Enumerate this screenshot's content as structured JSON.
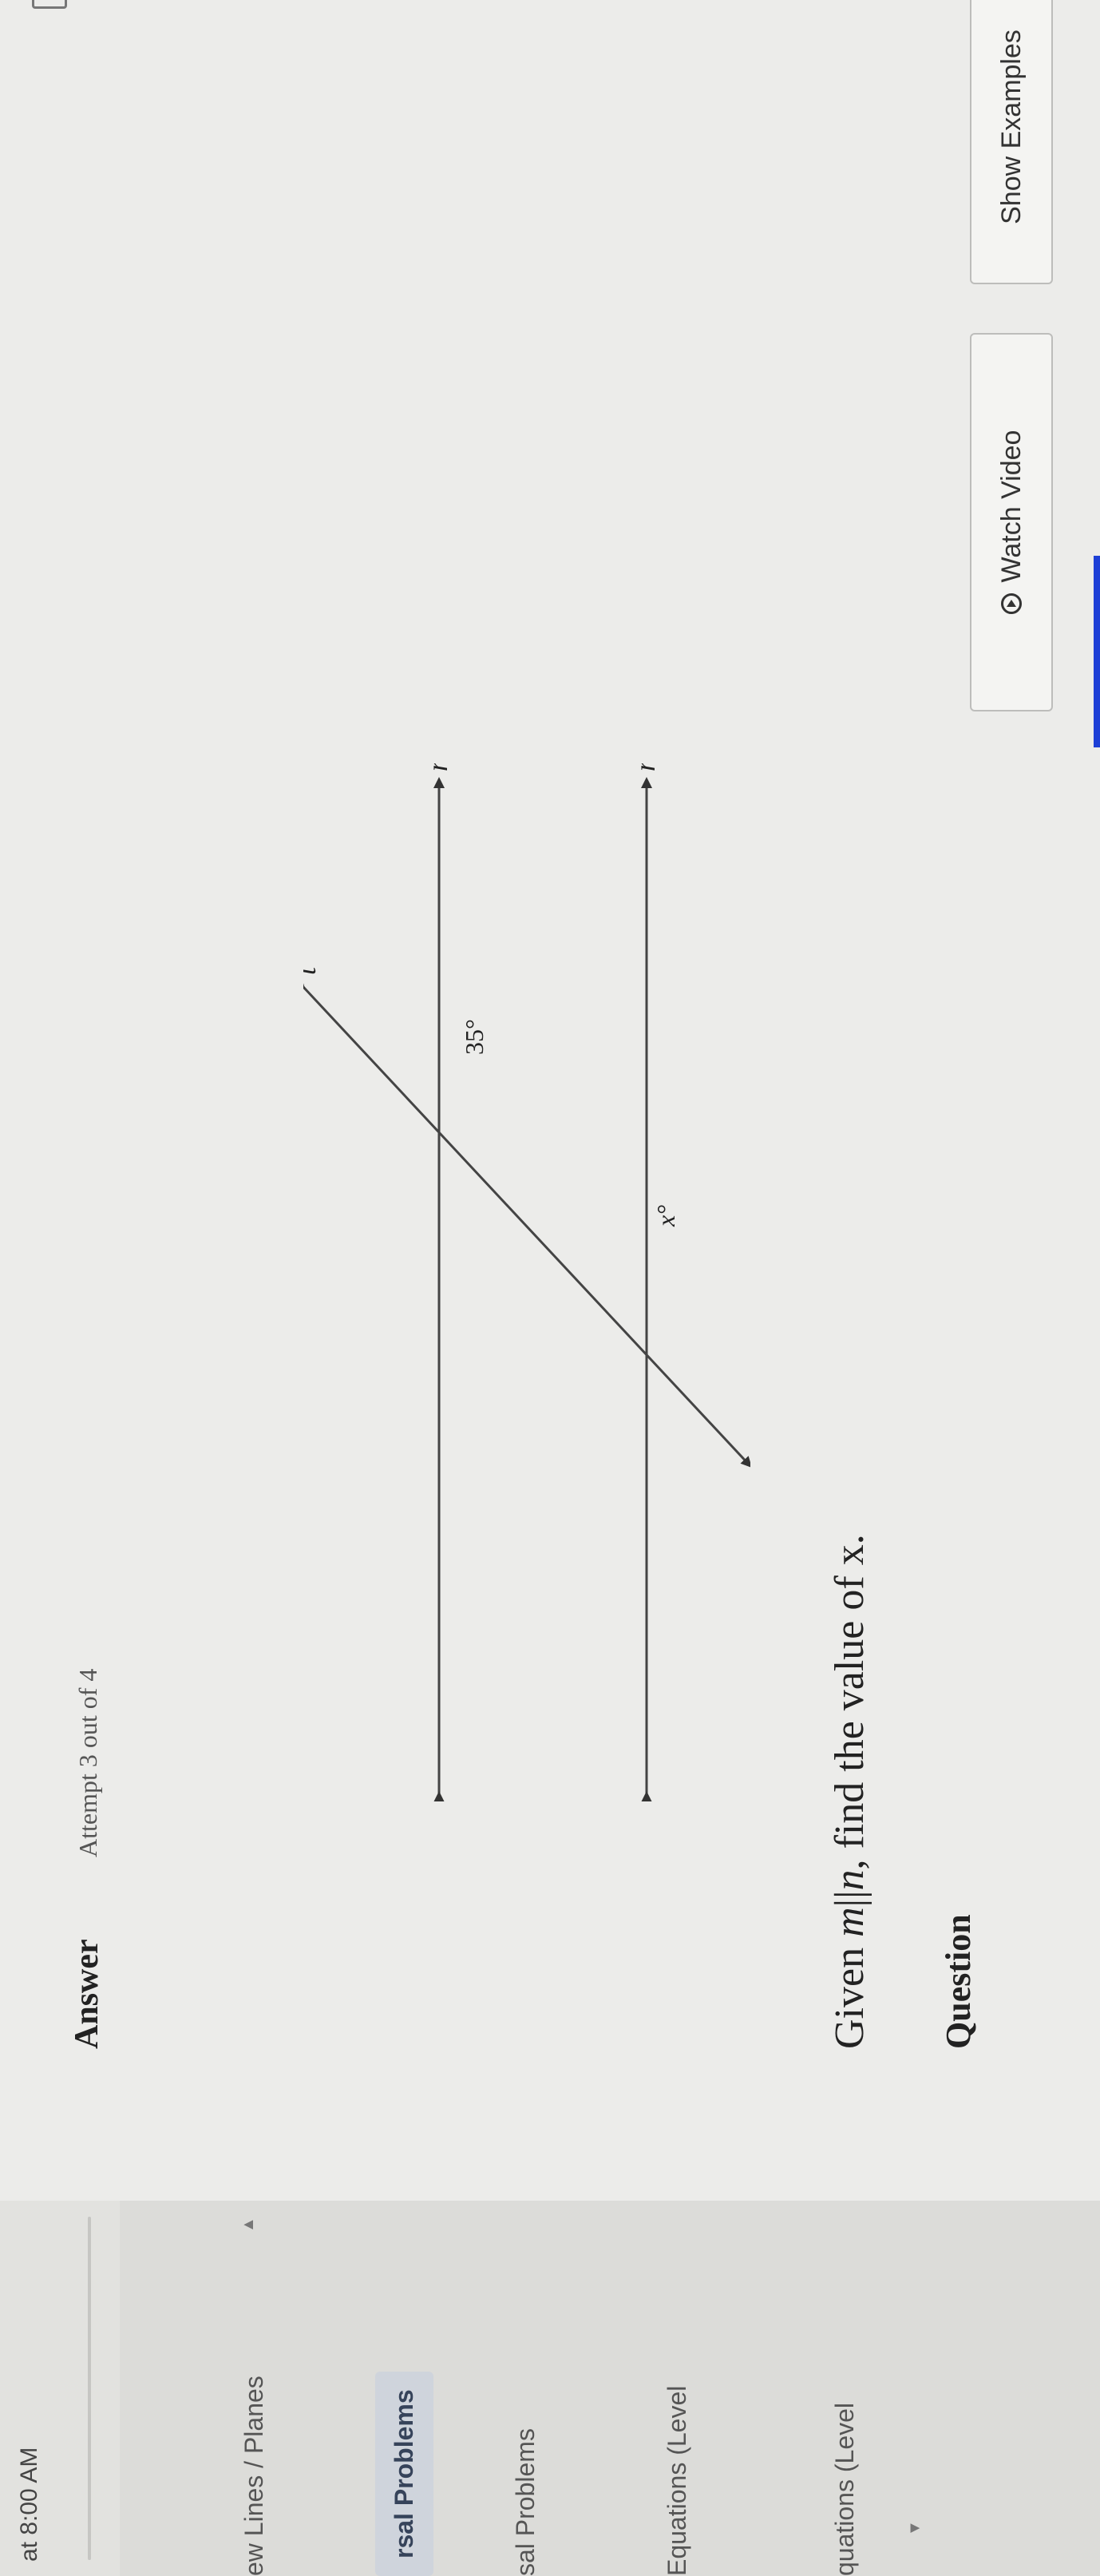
{
  "header": {
    "time": "at 8:00 AM"
  },
  "sidebar": {
    "items": [
      {
        "label": "ew Lines / Planes"
      },
      {
        "label": "rsal Problems"
      },
      {
        "label": "sal Problems"
      },
      {
        "label": "Equations (Level"
      },
      {
        "label": "quations (Level"
      }
    ]
  },
  "question": {
    "title": "Question",
    "prompt_pre": "Given ",
    "var_m": "m",
    "parallel": "||",
    "var_n": "n",
    "prompt_post": ", find the value of x."
  },
  "figure": {
    "line_m": "m",
    "line_n": "n",
    "transversal": "t",
    "angle_x": "x°",
    "angle_given": "35°"
  },
  "buttons": {
    "watch_video": "Watch Video",
    "show_examples": "Show Examples"
  },
  "answer": {
    "label": "Answer",
    "attempt": "Attempt 3 out of 4"
  }
}
